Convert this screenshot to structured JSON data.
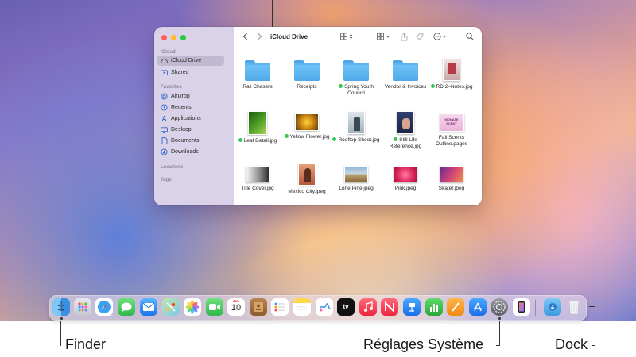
{
  "window": {
    "title": "iCloud Drive"
  },
  "sidebar": {
    "sections": {
      "icloud": "iCloud",
      "favorites": "Favorites",
      "locations": "Locations",
      "tags": "Tags"
    },
    "items": [
      {
        "label": "iCloud Drive",
        "icon": "cloud-icon"
      },
      {
        "label": "Shared",
        "icon": "shared-folder-icon"
      },
      {
        "label": "AirDrop",
        "icon": "airdrop-icon"
      },
      {
        "label": "Recents",
        "icon": "clock-icon"
      },
      {
        "label": "Applications",
        "icon": "applications-icon"
      },
      {
        "label": "Desktop",
        "icon": "desktop-icon"
      },
      {
        "label": "Documents",
        "icon": "document-icon"
      },
      {
        "label": "Downloads",
        "icon": "download-icon"
      }
    ]
  },
  "files": [
    {
      "name": "Rail Chasers",
      "kind": "folder"
    },
    {
      "name": "Receipts",
      "kind": "folder"
    },
    {
      "name": "Spring Youth Council",
      "kind": "folder",
      "tagged": true
    },
    {
      "name": "Vendor & Invoices",
      "kind": "folder"
    },
    {
      "name": "RD.2–Notes.jpg",
      "kind": "image",
      "tagged": true
    },
    {
      "name": "Leaf Detail.jpg",
      "kind": "image",
      "tagged": true
    },
    {
      "name": "Yellow Flower.jpg",
      "kind": "image",
      "tagged": true
    },
    {
      "name": "Rooftop Shoot.jpg",
      "kind": "image",
      "tagged": true
    },
    {
      "name": "Still Life Reference.jpg",
      "kind": "image",
      "tagged": true
    },
    {
      "name": "Fall Scents Outline.pages",
      "kind": "document"
    },
    {
      "name": "Title Cover.jpg",
      "kind": "image"
    },
    {
      "name": "Mexico City.jpeg",
      "kind": "image"
    },
    {
      "name": "Lone Pine.jpeg",
      "kind": "image"
    },
    {
      "name": "Pink.jpeg",
      "kind": "image"
    },
    {
      "name": "Skater.jpeg",
      "kind": "image"
    }
  ],
  "thumb_texts": {
    "pages_doc": "MONATE SCENT"
  },
  "dock": {
    "calendar_month": "JUL",
    "calendar_day": "10",
    "tv_label": "tv"
  },
  "captions": {
    "finder": "Finder",
    "settings": "Réglages Système",
    "dock": "Dock"
  },
  "colors": {
    "tag_green": "#35c759",
    "folder_blue": "#5cb5f0",
    "close": "#ff5f57",
    "minimize": "#febc2e",
    "zoom": "#28c840"
  }
}
